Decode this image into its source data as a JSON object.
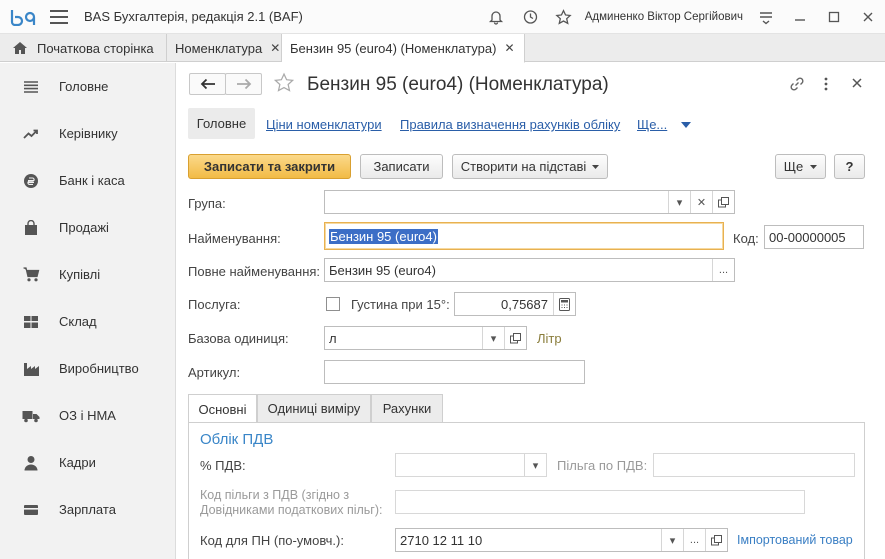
{
  "titlebar": {
    "app_title": "BAS Бухгалтерія, редакція 2.1  (BAF)",
    "user": "Админенко Віктор Сергійович"
  },
  "tabs": [
    {
      "label": "Початкова сторінка"
    },
    {
      "label": "Номенклатура"
    },
    {
      "label": "Бензин 95 (euro4) (Номенклатура)"
    }
  ],
  "sidebar": {
    "items": [
      {
        "label": "Головне",
        "icon": "list-icon"
      },
      {
        "label": "Керівнику",
        "icon": "trend-icon"
      },
      {
        "label": "Банк і каса",
        "icon": "coin-icon"
      },
      {
        "label": "Продажі",
        "icon": "bag-icon"
      },
      {
        "label": "Купівлі",
        "icon": "cart-icon"
      },
      {
        "label": "Склад",
        "icon": "grid-icon"
      },
      {
        "label": "Виробництво",
        "icon": "factory-icon"
      },
      {
        "label": "ОЗ і НМА",
        "icon": "truck-icon"
      },
      {
        "label": "Кадри",
        "icon": "person-icon"
      },
      {
        "label": "Зарплата",
        "icon": "wallet-icon"
      }
    ]
  },
  "form": {
    "title": "Бензин 95 (euro4) (Номенклатура)",
    "links": {
      "main": "Головне",
      "prices": "Ціни номенклатури",
      "rules": "Правила визначення рахунків обліку",
      "more": "Ще..."
    },
    "toolbar": {
      "save_close": "Записати та закрити",
      "save": "Записати",
      "create_based": "Створити на підставі",
      "more": "Ще",
      "help": "?"
    },
    "fields": {
      "group_label": "Група:",
      "group_value": "",
      "name_label": "Найменування:",
      "name_value": "Бензин 95 (euro4)",
      "code_label": "Код:",
      "code_value": "00-00000005",
      "full_name_label": "Повне найменування:",
      "full_name_value": "Бензин 95 (euro4)",
      "service_label": "Послуга:",
      "density_label": "Густина при 15°:",
      "density_value": "0,75687",
      "unit_label": "Базова одиниця:",
      "unit_value": "л",
      "unit_name": "Літр",
      "article_label": "Артикул:",
      "article_value": ""
    },
    "inner_tabs": [
      "Основні",
      "Одиниці виміру",
      "Рахунки"
    ],
    "vat": {
      "section": "Облік ПДВ",
      "vat_label": "% ПДВ:",
      "vat_value": "",
      "benefit_label": "Пільга по ПДВ:",
      "benefit_value": "",
      "benefit_code_label1": "Код пільги з ПДВ (згідно з",
      "benefit_code_label2": "Довідниками податкових пільг):",
      "benefit_code_value": "",
      "pn_label": "Код для ПН (по-умовч.):",
      "pn_value": "2710 12 11 10",
      "imported": "Імпортований товар"
    }
  }
}
